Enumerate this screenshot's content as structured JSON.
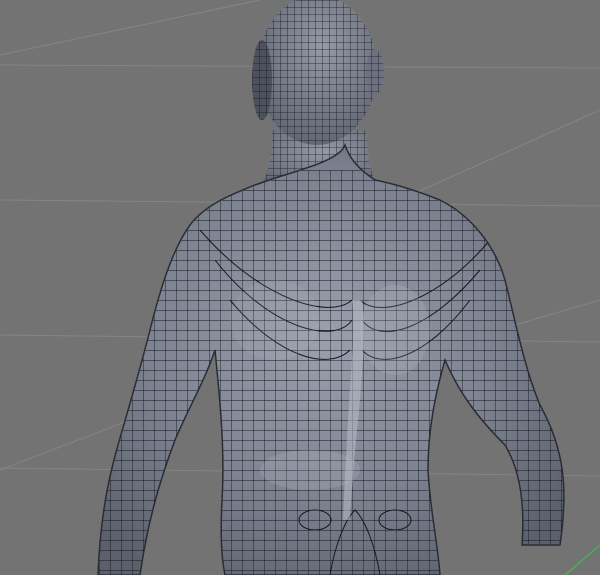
{
  "viewport": {
    "background": "#737373",
    "grid_color": "#8a8a8a",
    "axis_color": "#4caf50"
  },
  "model": {
    "view": "back",
    "shading": "solid-gray",
    "skin_color": "#7f8493",
    "wire_color": "#111318",
    "highlight_color": "#b9bcc6"
  }
}
